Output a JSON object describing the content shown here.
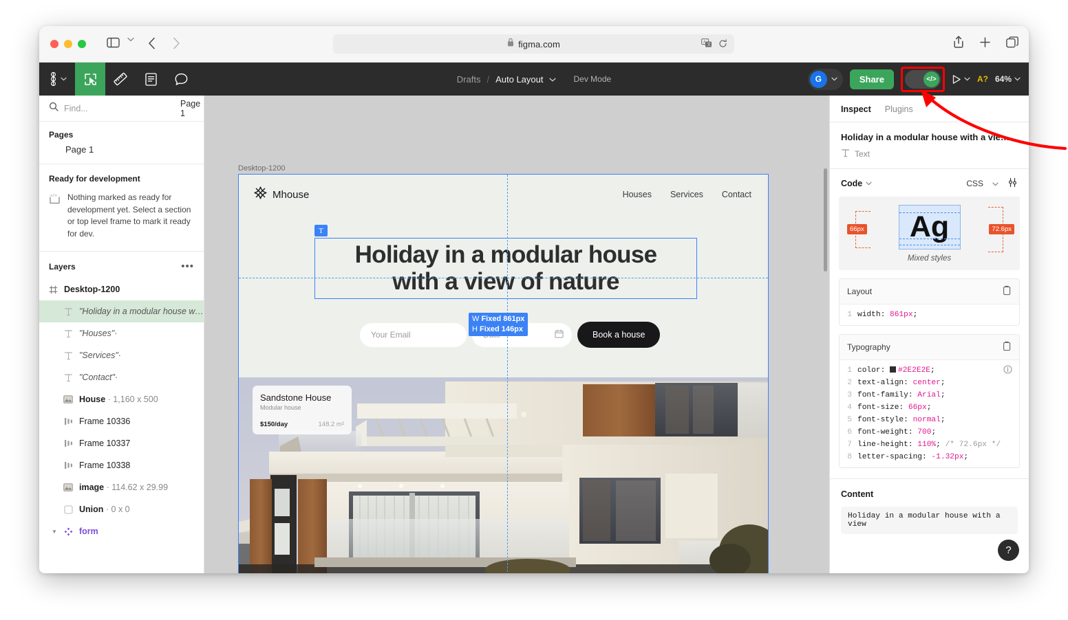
{
  "browser": {
    "url": "figma.com",
    "lock_icon": "lock-icon",
    "translate_icon": "translate-icon",
    "reload_icon": "reload-icon",
    "sidebar_icon": "sidebar-toggle-icon",
    "back_icon": "chevron-left-icon",
    "forward_icon": "chevron-right-icon",
    "share_icon": "share-upload-icon",
    "new_tab_icon": "plus-icon",
    "tabs_icon": "copy-tabs-icon"
  },
  "toolbar": {
    "logo_icon": "figma-logo-icon",
    "tools": [
      {
        "name": "move-tool",
        "icon": "cursor-frame-icon",
        "active": true
      },
      {
        "name": "measure-tool",
        "icon": "ruler-icon",
        "active": false
      },
      {
        "name": "annotate-tool",
        "icon": "document-icon",
        "active": false
      },
      {
        "name": "comment-tool",
        "icon": "comment-bubble-icon",
        "active": false
      }
    ],
    "breadcrumb": {
      "project": "Drafts",
      "separator": "/",
      "file": "Auto Layout",
      "mode": "Dev Mode"
    },
    "avatar_initial": "G",
    "share_label": "Share",
    "devmode_icon": "</>",
    "present_icon": "play-icon",
    "a_badge": "A?",
    "zoom_level": "64%"
  },
  "left_panel": {
    "find_placeholder": "Find...",
    "page_select": "Page 1",
    "pages_title": "Pages",
    "pages": [
      "Page 1"
    ],
    "ready_title": "Ready for development",
    "ready_text": "Nothing marked as ready for development yet. Select a section or top level frame to mark it ready for dev.",
    "layers_title": "Layers",
    "layers": [
      {
        "name": "Desktop-1200",
        "icon": "frame-icon",
        "italic": false,
        "bold": true,
        "indent": false,
        "selected": false,
        "dim": ""
      },
      {
        "name": "\"Holiday in a modular house w…·",
        "icon": "text-icon",
        "italic": true,
        "bold": false,
        "indent": true,
        "selected": true,
        "dim": ""
      },
      {
        "name": "\"Houses\"·",
        "icon": "text-icon",
        "italic": true,
        "bold": false,
        "indent": true,
        "selected": false,
        "dim": ""
      },
      {
        "name": "\"Services\"·",
        "icon": "text-icon",
        "italic": true,
        "bold": false,
        "indent": true,
        "selected": false,
        "dim": ""
      },
      {
        "name": "\"Contact\"·",
        "icon": "text-icon",
        "italic": true,
        "bold": false,
        "indent": true,
        "selected": false,
        "dim": ""
      },
      {
        "name": "House",
        "icon": "image-icon",
        "italic": false,
        "bold": true,
        "indent": true,
        "selected": false,
        "dim": " · 1,160 x 500"
      },
      {
        "name": "Frame 10336",
        "icon": "autolayout-icon",
        "italic": false,
        "bold": false,
        "indent": true,
        "selected": false,
        "dim": ""
      },
      {
        "name": "Frame 10337",
        "icon": "autolayout-icon",
        "italic": false,
        "bold": false,
        "indent": true,
        "selected": false,
        "dim": ""
      },
      {
        "name": "Frame 10338",
        "icon": "autolayout-icon",
        "italic": false,
        "bold": false,
        "indent": true,
        "selected": false,
        "dim": ""
      },
      {
        "name": "image",
        "icon": "image-icon",
        "italic": false,
        "bold": true,
        "indent": true,
        "selected": false,
        "dim": " · 114.62 x 29.99"
      },
      {
        "name": "Union",
        "icon": "union-icon",
        "italic": false,
        "bold": true,
        "indent": true,
        "selected": false,
        "dim": " · 0 x 0"
      },
      {
        "name": "form",
        "icon": "component-icon",
        "italic": false,
        "bold": true,
        "indent": true,
        "selected": false,
        "dim": "",
        "component": true
      }
    ]
  },
  "canvas": {
    "frame_label": "Desktop-1200",
    "logo_text": "Mhouse",
    "logo_icon": "mhouse-star-icon",
    "nav_links": [
      "Houses",
      "Services",
      "Contact"
    ],
    "heading_line1": "Holiday in a modular house",
    "heading_line2": "with a view of nature",
    "text_badge": "T",
    "size_tip": {
      "w_label": "W",
      "w_value": "Fixed  861px",
      "h_label": "H",
      "h_value": "Fixed  146px"
    },
    "email_placeholder": "Your Email",
    "date_placeholder": "Date",
    "calendar_icon": "calendar-icon",
    "book_button": "Book a house",
    "card": {
      "title": "Sandstone House",
      "subtitle": "Modular house",
      "price": "$150/day",
      "area": "148.2 m²"
    }
  },
  "inspect": {
    "tabs": [
      {
        "label": "Inspect",
        "active": true
      },
      {
        "label": "Plugins",
        "active": false
      }
    ],
    "selection_title": "Holiday in a modular house with a vie…",
    "selection_type": "Text",
    "type_icon": "text-icon",
    "code_label": "Code",
    "language": "CSS",
    "settings_icon": "sliders-icon",
    "preview": {
      "glyph": "Ag",
      "left_tag": "66px",
      "right_tag": "72.6px",
      "caption": "Mixed styles"
    },
    "layout": {
      "title": "Layout",
      "copy_icon": "clipboard-icon",
      "lines": [
        {
          "n": "1",
          "prop": "width: ",
          "value": "861px",
          "tail": ";"
        }
      ]
    },
    "typography": {
      "title": "Typography",
      "copy_icon": "clipboard-icon",
      "info_icon": "info-icon",
      "lines": [
        {
          "n": "1",
          "prop": "color: ",
          "swatch": "#2E2E2E",
          "value": "#2E2E2E",
          "tail": ";"
        },
        {
          "n": "2",
          "prop": "text-align: ",
          "value": "center",
          "tail": ";"
        },
        {
          "n": "3",
          "prop": "font-family: ",
          "value": "Arial",
          "tail": ";"
        },
        {
          "n": "4",
          "prop": "font-size: ",
          "value": "66px",
          "tail": ";"
        },
        {
          "n": "5",
          "prop": "font-style: ",
          "value": "normal",
          "tail": ";"
        },
        {
          "n": "6",
          "prop": "font-weight: ",
          "value": "700",
          "tail": ";"
        },
        {
          "n": "7",
          "prop": "line-height: ",
          "value": "110%",
          "tail": ";",
          "comment": " /* 72.6px */"
        },
        {
          "n": "8",
          "prop": "letter-spacing: ",
          "value": "-1.32px",
          "tail": ";"
        }
      ]
    },
    "content": {
      "title": "Content",
      "text": "Holiday in a modular house with a view"
    },
    "help_icon": "?"
  },
  "annotation": {
    "arrow_color": "#ff0000",
    "highlight_color": "#ff0000"
  }
}
